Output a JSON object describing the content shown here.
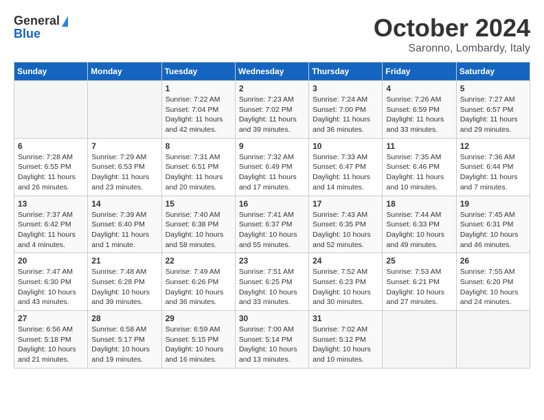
{
  "header": {
    "logo_general": "General",
    "logo_blue": "Blue",
    "title": "October 2024",
    "location": "Saronno, Lombardy, Italy"
  },
  "days_of_week": [
    "Sunday",
    "Monday",
    "Tuesday",
    "Wednesday",
    "Thursday",
    "Friday",
    "Saturday"
  ],
  "weeks": [
    [
      {
        "day": "",
        "sunrise": "",
        "sunset": "",
        "daylight": ""
      },
      {
        "day": "",
        "sunrise": "",
        "sunset": "",
        "daylight": ""
      },
      {
        "day": "1",
        "sunrise": "Sunrise: 7:22 AM",
        "sunset": "Sunset: 7:04 PM",
        "daylight": "Daylight: 11 hours and 42 minutes."
      },
      {
        "day": "2",
        "sunrise": "Sunrise: 7:23 AM",
        "sunset": "Sunset: 7:02 PM",
        "daylight": "Daylight: 11 hours and 39 minutes."
      },
      {
        "day": "3",
        "sunrise": "Sunrise: 7:24 AM",
        "sunset": "Sunset: 7:00 PM",
        "daylight": "Daylight: 11 hours and 36 minutes."
      },
      {
        "day": "4",
        "sunrise": "Sunrise: 7:26 AM",
        "sunset": "Sunset: 6:59 PM",
        "daylight": "Daylight: 11 hours and 33 minutes."
      },
      {
        "day": "5",
        "sunrise": "Sunrise: 7:27 AM",
        "sunset": "Sunset: 6:57 PM",
        "daylight": "Daylight: 11 hours and 29 minutes."
      }
    ],
    [
      {
        "day": "6",
        "sunrise": "Sunrise: 7:28 AM",
        "sunset": "Sunset: 6:55 PM",
        "daylight": "Daylight: 11 hours and 26 minutes."
      },
      {
        "day": "7",
        "sunrise": "Sunrise: 7:29 AM",
        "sunset": "Sunset: 6:53 PM",
        "daylight": "Daylight: 11 hours and 23 minutes."
      },
      {
        "day": "8",
        "sunrise": "Sunrise: 7:31 AM",
        "sunset": "Sunset: 6:51 PM",
        "daylight": "Daylight: 11 hours and 20 minutes."
      },
      {
        "day": "9",
        "sunrise": "Sunrise: 7:32 AM",
        "sunset": "Sunset: 6:49 PM",
        "daylight": "Daylight: 11 hours and 17 minutes."
      },
      {
        "day": "10",
        "sunrise": "Sunrise: 7:33 AM",
        "sunset": "Sunset: 6:47 PM",
        "daylight": "Daylight: 11 hours and 14 minutes."
      },
      {
        "day": "11",
        "sunrise": "Sunrise: 7:35 AM",
        "sunset": "Sunset: 6:46 PM",
        "daylight": "Daylight: 11 hours and 10 minutes."
      },
      {
        "day": "12",
        "sunrise": "Sunrise: 7:36 AM",
        "sunset": "Sunset: 6:44 PM",
        "daylight": "Daylight: 11 hours and 7 minutes."
      }
    ],
    [
      {
        "day": "13",
        "sunrise": "Sunrise: 7:37 AM",
        "sunset": "Sunset: 6:42 PM",
        "daylight": "Daylight: 11 hours and 4 minutes."
      },
      {
        "day": "14",
        "sunrise": "Sunrise: 7:39 AM",
        "sunset": "Sunset: 6:40 PM",
        "daylight": "Daylight: 11 hours and 1 minute."
      },
      {
        "day": "15",
        "sunrise": "Sunrise: 7:40 AM",
        "sunset": "Sunset: 6:38 PM",
        "daylight": "Daylight: 10 hours and 58 minutes."
      },
      {
        "day": "16",
        "sunrise": "Sunrise: 7:41 AM",
        "sunset": "Sunset: 6:37 PM",
        "daylight": "Daylight: 10 hours and 55 minutes."
      },
      {
        "day": "17",
        "sunrise": "Sunrise: 7:43 AM",
        "sunset": "Sunset: 6:35 PM",
        "daylight": "Daylight: 10 hours and 52 minutes."
      },
      {
        "day": "18",
        "sunrise": "Sunrise: 7:44 AM",
        "sunset": "Sunset: 6:33 PM",
        "daylight": "Daylight: 10 hours and 49 minutes."
      },
      {
        "day": "19",
        "sunrise": "Sunrise: 7:45 AM",
        "sunset": "Sunset: 6:31 PM",
        "daylight": "Daylight: 10 hours and 46 minutes."
      }
    ],
    [
      {
        "day": "20",
        "sunrise": "Sunrise: 7:47 AM",
        "sunset": "Sunset: 6:30 PM",
        "daylight": "Daylight: 10 hours and 43 minutes."
      },
      {
        "day": "21",
        "sunrise": "Sunrise: 7:48 AM",
        "sunset": "Sunset: 6:28 PM",
        "daylight": "Daylight: 10 hours and 39 minutes."
      },
      {
        "day": "22",
        "sunrise": "Sunrise: 7:49 AM",
        "sunset": "Sunset: 6:26 PM",
        "daylight": "Daylight: 10 hours and 36 minutes."
      },
      {
        "day": "23",
        "sunrise": "Sunrise: 7:51 AM",
        "sunset": "Sunset: 6:25 PM",
        "daylight": "Daylight: 10 hours and 33 minutes."
      },
      {
        "day": "24",
        "sunrise": "Sunrise: 7:52 AM",
        "sunset": "Sunset: 6:23 PM",
        "daylight": "Daylight: 10 hours and 30 minutes."
      },
      {
        "day": "25",
        "sunrise": "Sunrise: 7:53 AM",
        "sunset": "Sunset: 6:21 PM",
        "daylight": "Daylight: 10 hours and 27 minutes."
      },
      {
        "day": "26",
        "sunrise": "Sunrise: 7:55 AM",
        "sunset": "Sunset: 6:20 PM",
        "daylight": "Daylight: 10 hours and 24 minutes."
      }
    ],
    [
      {
        "day": "27",
        "sunrise": "Sunrise: 6:56 AM",
        "sunset": "Sunset: 5:18 PM",
        "daylight": "Daylight: 10 hours and 21 minutes."
      },
      {
        "day": "28",
        "sunrise": "Sunrise: 6:58 AM",
        "sunset": "Sunset: 5:17 PM",
        "daylight": "Daylight: 10 hours and 19 minutes."
      },
      {
        "day": "29",
        "sunrise": "Sunrise: 6:59 AM",
        "sunset": "Sunset: 5:15 PM",
        "daylight": "Daylight: 10 hours and 16 minutes."
      },
      {
        "day": "30",
        "sunrise": "Sunrise: 7:00 AM",
        "sunset": "Sunset: 5:14 PM",
        "daylight": "Daylight: 10 hours and 13 minutes."
      },
      {
        "day": "31",
        "sunrise": "Sunrise: 7:02 AM",
        "sunset": "Sunset: 5:12 PM",
        "daylight": "Daylight: 10 hours and 10 minutes."
      },
      {
        "day": "",
        "sunrise": "",
        "sunset": "",
        "daylight": ""
      },
      {
        "day": "",
        "sunrise": "",
        "sunset": "",
        "daylight": ""
      }
    ]
  ]
}
